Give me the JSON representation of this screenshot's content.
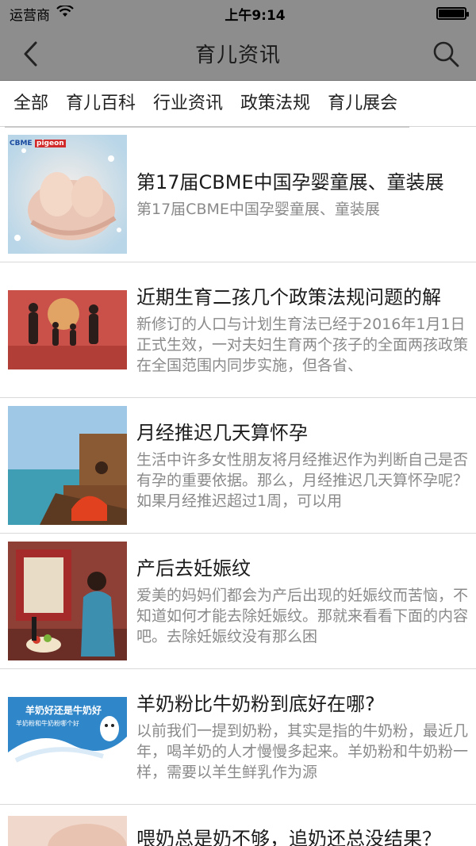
{
  "status_bar": {
    "carrier": "运营商",
    "time": "上午9:14"
  },
  "nav": {
    "title": "育儿资讯"
  },
  "tabs": [
    "全部",
    "育儿百科",
    "行业资讯",
    "政策法规",
    "育儿展会"
  ],
  "articles": [
    {
      "title": "第17届CBME中国孕婴童展、童装展",
      "desc": "第17届CBME中国孕婴童展、童装展"
    },
    {
      "title": "近期生育二孩几个政策法规问题的解",
      "desc": "新修订的人口与计划生育法已经于2016年1月1日正式生效，一对夫妇生育两个孩子的全面两孩政策在全国范围内同步实施，但各省、"
    },
    {
      "title": "月经推迟几天算怀孕",
      "desc": "生活中许多女性朋友将月经推迟作为判断自己是否有孕的重要依据。那么，月经推迟几天算怀孕呢？如果月经推迟超过1周，可以用"
    },
    {
      "title": "产后去妊娠纹",
      "desc": "爱美的妈妈们都会为产后出现的妊娠纹而苦恼，不知道如何才能去除妊娠纹。那就来看看下面的内容吧。去除妊娠纹没有那么困"
    },
    {
      "title": "羊奶粉比牛奶粉到底好在哪?",
      "desc": "以前我们一提到奶粉，其实是指的牛奶粉，最近几年，喝羊奶的人才慢慢多起来。羊奶粉和牛奶粉一样，需要以羊生鲜乳作为源"
    },
    {
      "title": "喂奶总是奶不够，追奶还总没结果？",
      "desc": ""
    }
  ],
  "thumb_text": {
    "cbme_logo": "CBME",
    "pigeon_logo": "pigeon",
    "milk_banner": "羊奶好还是牛奶好",
    "milk_sub": "羊奶粉和牛奶粉哪个好"
  }
}
